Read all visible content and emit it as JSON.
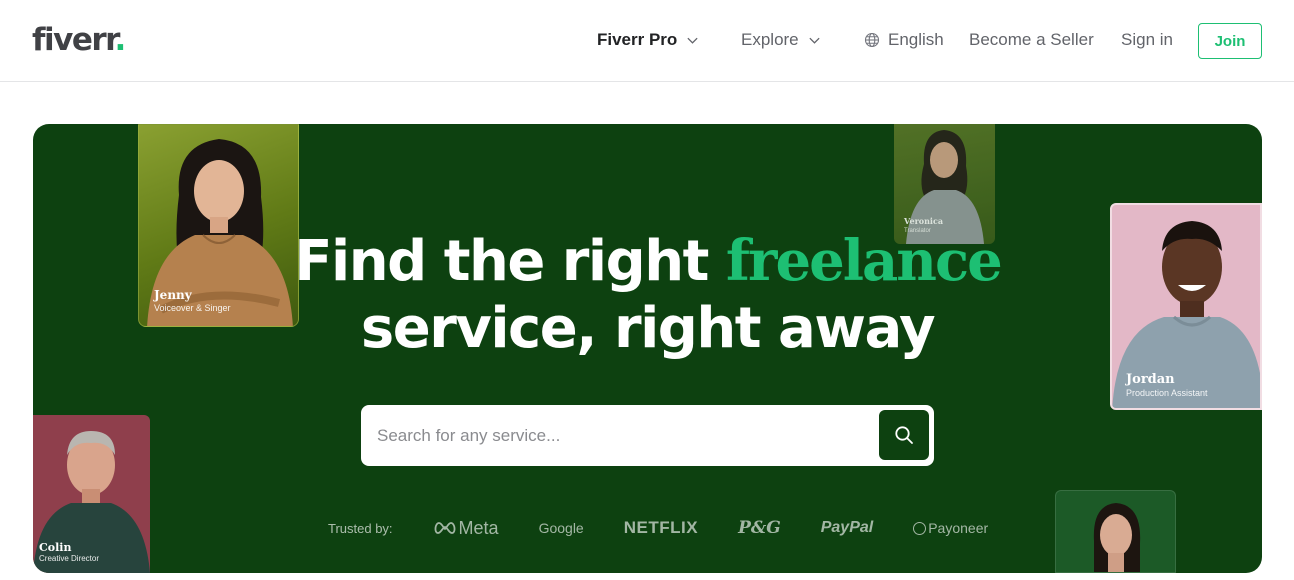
{
  "header": {
    "logo_text": "fiverr",
    "logo_dot": ".",
    "nav": {
      "fiverr_pro": "Fiverr Pro",
      "explore": "Explore",
      "language": "English",
      "become_seller": "Become a Seller",
      "sign_in": "Sign in",
      "join": "Join"
    }
  },
  "hero": {
    "title_line1_prefix": "Find the right ",
    "title_accent": "freelance",
    "title_line2": "service, right away",
    "search": {
      "placeholder": "Search for any service..."
    },
    "trusted": {
      "label": "Trusted by:",
      "brands": [
        "Meta",
        "Google",
        "NETFLIX",
        "P&G",
        "PayPal",
        "Payoneer"
      ]
    },
    "freelancers": [
      {
        "name": "Jenny",
        "role": "Voiceover & Singer"
      },
      {
        "name": "Veronica",
        "role": "Translator"
      },
      {
        "name": "Jordan",
        "role": "Production Assistant"
      },
      {
        "name": "Colin",
        "role": "Creative Director"
      }
    ]
  },
  "colors": {
    "brand_green": "#1dbf73",
    "hero_background": "#0d4110",
    "text_dark": "#404145"
  },
  "icons": [
    "chevron-down-icon",
    "globe-icon",
    "search-icon",
    "meta-infinity-icon"
  ]
}
